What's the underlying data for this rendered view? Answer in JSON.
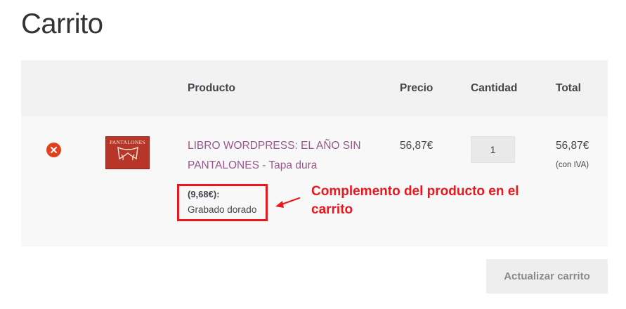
{
  "page": {
    "title": "Carrito"
  },
  "table": {
    "headers": {
      "product": "Producto",
      "price": "Precio",
      "quantity": "Cantidad",
      "total": "Total"
    },
    "rows": [
      {
        "remove_icon": "close-circle-icon",
        "thumbnail_text": "PANTALONES",
        "product_name": "LIBRO WORDPRESS: EL AÑO SIN PANTALONES - Tapa dura",
        "addon_price": "(9,68€):",
        "addon_name": "Grabado dorado",
        "price": "56,87€",
        "quantity": "1",
        "total": "56,87€",
        "tax_note": "(con IVA)"
      }
    ]
  },
  "annotation": {
    "text": "Complemento del producto en el carrito"
  },
  "actions": {
    "update_cart": "Actualizar carrito"
  },
  "colors": {
    "accent": "#96588a",
    "remove": "#e2401c",
    "highlight": "#e8191e"
  }
}
